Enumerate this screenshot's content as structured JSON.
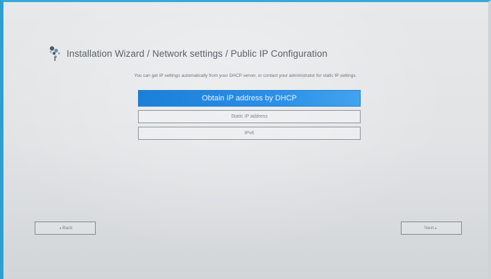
{
  "header": {
    "title": "Installation Wizard / Network settings / Public IP Configuration"
  },
  "instructions": "You can get IP settings automatically from your DHCP server, or contact your administrator for static IP settings.",
  "options": [
    {
      "label": "Obtain IP address by DHCP",
      "selected": true
    },
    {
      "label": "Static IP address",
      "selected": false
    },
    {
      "label": "IPv6",
      "selected": false
    }
  ],
  "nav": {
    "back_label": "Back",
    "next_label": "Next",
    "back_arrow": "◂",
    "next_arrow": "▸"
  },
  "colors": {
    "accent": "#2b8fe6",
    "frame": "#35a9d6"
  },
  "icons": {
    "logo": "tree-logo-icon"
  }
}
